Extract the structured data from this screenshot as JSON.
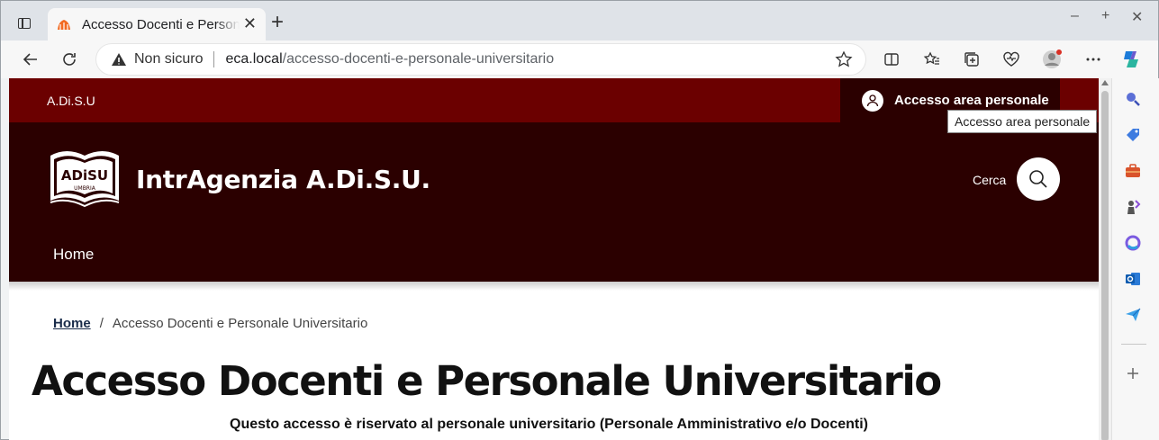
{
  "browser": {
    "tab_title": "Accesso Docenti e Personale Universitario",
    "new_tab": "+",
    "close_tab": "✕",
    "address": {
      "security_label": "Non sicuro",
      "host": "eca.local",
      "path": "/accesso-docenti-e-personale-universitario"
    },
    "window_controls": [
      "–",
      "+",
      "✕"
    ]
  },
  "site": {
    "top_org": "A.Di.S.U",
    "login_label": "Accesso area personale",
    "login_tooltip": "Accesso area personale",
    "brand_name": "IntrAgenzia A.Di.S.U.",
    "logo_text_main": "ADiSU",
    "logo_text_sub": "UMBRIA",
    "search_label": "Cerca",
    "nav": [
      {
        "label": "Home"
      }
    ],
    "colors": {
      "topbar": "#6b0000",
      "header": "#2b0000"
    }
  },
  "breadcrumb": {
    "home": "Home",
    "separator": "/",
    "current": "Accesso Docenti e Personale Universitario"
  },
  "page": {
    "title": "Accesso Docenti e Personale Universitario",
    "notice": "Questo accesso è riservato al personale universitario (Personale Amministrativo e/o Docenti)"
  }
}
